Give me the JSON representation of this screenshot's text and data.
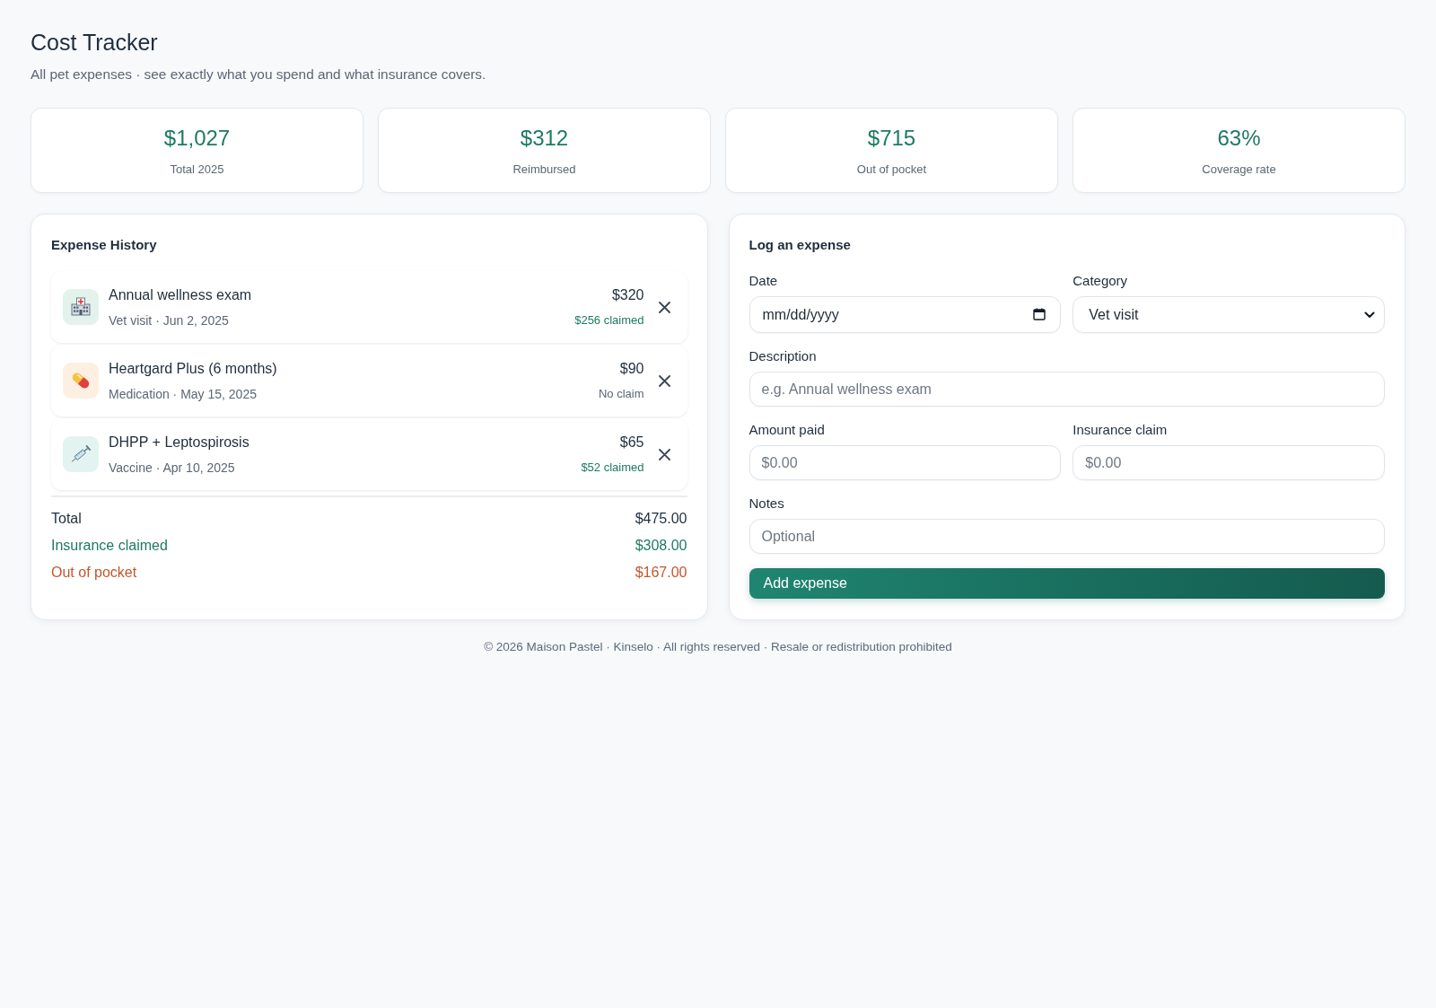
{
  "header": {
    "title": "Cost Tracker",
    "subtitle": "All pet expenses · see exactly what you spend and what insurance covers."
  },
  "stats": [
    {
      "value": "$1,027",
      "label": "Total 2025"
    },
    {
      "value": "$312",
      "label": "Reimbursed"
    },
    {
      "value": "$715",
      "label": "Out of pocket"
    },
    {
      "value": "63%",
      "label": "Coverage rate"
    }
  ],
  "expense_history": {
    "title": "Expense History",
    "items": [
      {
        "kind": "vet_visit",
        "title": "Annual wellness exam",
        "meta": "Vet visit · Jun 2, 2025",
        "amount": "$320",
        "claim": "$256 claimed",
        "claimed": true
      },
      {
        "kind": "medication",
        "title": "Heartgard Plus (6 months)",
        "meta": "Medication · May 15, 2025",
        "amount": "$90",
        "claim": "No claim",
        "claimed": false
      },
      {
        "kind": "vaccine",
        "title": "DHPP + Leptospirosis",
        "meta": "Vaccine · Apr 10, 2025",
        "amount": "$65",
        "claim": "$52 claimed",
        "claimed": true
      }
    ],
    "summary": [
      {
        "kind": "total",
        "label": "Total",
        "value": "$475.00"
      },
      {
        "kind": "claimed",
        "label": "Insurance claimed",
        "value": "$308.00"
      },
      {
        "kind": "out_of_pocket",
        "label": "Out of pocket",
        "value": "$167.00"
      }
    ]
  },
  "log_form": {
    "title": "Log an expense",
    "rows": [
      [
        {
          "kind": "date",
          "label": "Date",
          "placeholder": "mm/dd/yyyy"
        },
        {
          "kind": "select",
          "label": "Category",
          "value": "Vet visit"
        }
      ],
      [
        {
          "kind": "text",
          "label": "Description",
          "placeholder": "e.g. Annual wellness exam"
        }
      ],
      [
        {
          "kind": "text",
          "label": "Amount paid",
          "placeholder": "$0.00"
        },
        {
          "kind": "text",
          "label": "Insurance claim",
          "placeholder": "$0.00"
        }
      ],
      [
        {
          "kind": "text",
          "label": "Notes",
          "placeholder": "Optional"
        }
      ]
    ],
    "submit": "Add expense"
  },
  "footer": "© 2026 Maison Pastel · Kinselo · All rights reserved · Resale or redistribution prohibited"
}
